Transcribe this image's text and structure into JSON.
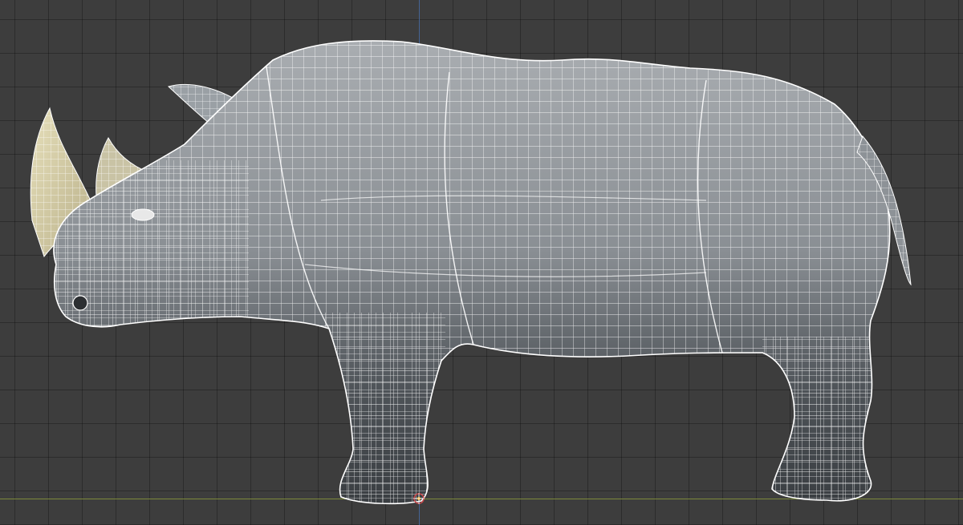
{
  "viewport": {
    "model": "rhino-wireframe-mesh",
    "view": "side",
    "background_color": "#3d3d3d",
    "grid_color": "#2f2f2f",
    "axis_x_color": "#7d8a3a",
    "axis_z_color": "#4a6fa8",
    "mesh_fill_color": "#8a8f94",
    "wire_color": "#ffffff",
    "horn_color": "#d9d2aa",
    "origin_icon": "object-origin-icon"
  }
}
